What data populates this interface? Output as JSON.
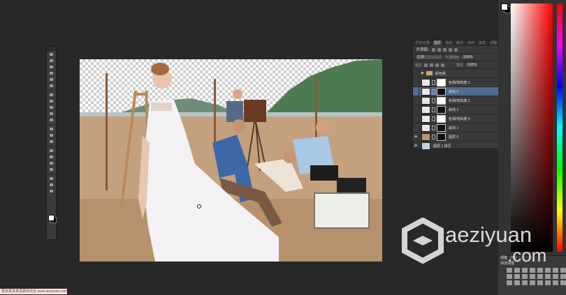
{
  "app": {
    "name": "Photoshop"
  },
  "toolbar": {
    "tools": [
      "move-tool",
      "marquee-tool",
      "lasso-tool",
      "quick-select-tool",
      "crop-tool",
      "eyedropper-tool",
      "healing-brush-tool",
      "brush-tool",
      "clone-stamp-tool",
      "history-brush-tool",
      "eraser-tool",
      "gradient-tool",
      "blur-tool",
      "dodge-tool",
      "pen-tool",
      "type-tool",
      "path-select-tool",
      "shape-tool",
      "hand-tool",
      "zoom-tool",
      "extra-tool"
    ],
    "foreground_color": "#ffffff",
    "background_color": "#000000"
  },
  "layers_panel": {
    "tabs": [
      "历史记录",
      "图层",
      "通道",
      "路径",
      "动作",
      "属性",
      "调整"
    ],
    "active_tab": "图层",
    "filter_label": "P 类型",
    "blend_mode": "正常",
    "opacity_label": "不透明度",
    "opacity_value": "100%",
    "lock_label": "锁定",
    "fill_label": "填充",
    "fill_value": "100%",
    "group_label": "颜色组",
    "layers": [
      {
        "name": "色相/饱和度 1",
        "selected": false
      },
      {
        "name": "曲线 2",
        "selected": true
      },
      {
        "name": "色相/饱和度 2",
        "selected": false
      },
      {
        "name": "曲线 2",
        "selected": false
      },
      {
        "name": "色相/饱和度 3",
        "selected": false
      },
      {
        "name": "曲线 1",
        "selected": false
      },
      {
        "name": "图层 0",
        "selected": false
      },
      {
        "name": "图层 1 拷贝",
        "selected": false
      }
    ]
  },
  "adjustments_panel": {
    "tabs": [
      "调整",
      "样式"
    ],
    "active_tab": "调整",
    "label": "添加调整"
  },
  "watermark": {
    "line1": "aeziyuan",
    "line2": ".com"
  },
  "status": {
    "left_text": "更多更多高清素材点击 www.aeziyuan.com"
  },
  "colors": {
    "workspace": "#282828",
    "panel": "#3a3a3a",
    "selection": "#4f6b8d"
  }
}
